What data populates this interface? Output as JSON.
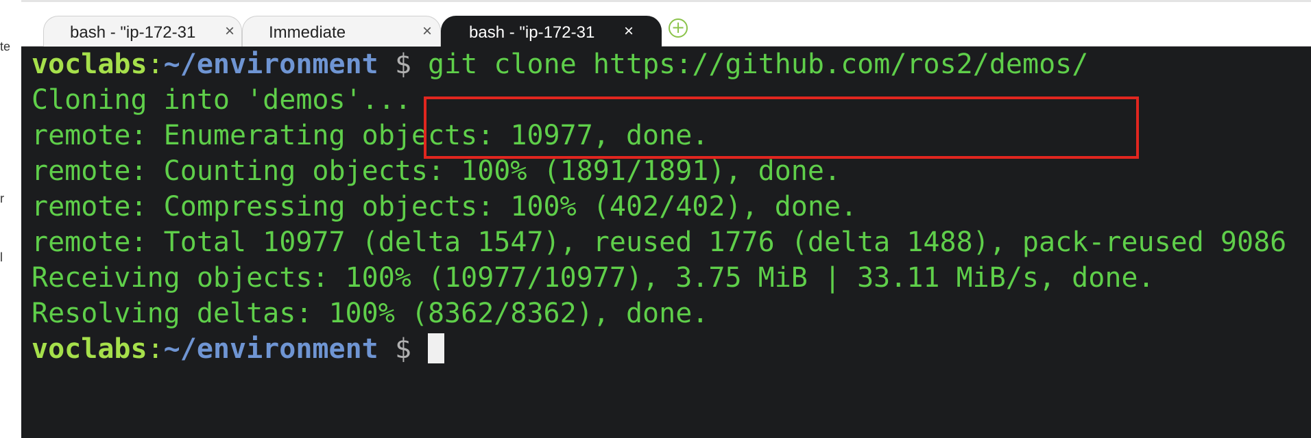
{
  "left_strip": {
    "fragments": [
      "te",
      "r",
      "l"
    ]
  },
  "tabs": [
    {
      "label": "bash - \"ip-172-31",
      "close": "×",
      "active": false
    },
    {
      "label": "Immediate",
      "close": "×",
      "active": false
    },
    {
      "label": "bash - \"ip-172-31",
      "close": "×",
      "active": true
    }
  ],
  "add_tab": {
    "icon": "plus-circle-icon",
    "glyph": "+"
  },
  "colors": {
    "terminal_bg": "#1b1c1e",
    "output_green": "#5fcf4a",
    "host_green": "#a6e04b",
    "path_blue": "#6f95d3",
    "highlight_red": "#e1261f"
  },
  "terminal": {
    "prompt": {
      "host": "voclabs",
      "colon": ":",
      "path": "~/environment",
      "symbol": "$"
    },
    "command": "git clone https://github.com/ros2/demos/",
    "output": [
      "Cloning into 'demos'...",
      "remote: Enumerating objects: 10977, done.",
      "remote: Counting objects: 100% (1891/1891), done.",
      "remote: Compressing objects: 100% (402/402), done.",
      "remote: Total 10977 (delta 1547), reused 1776 (delta 1488), pack-reused 9086",
      "Receiving objects: 100% (10977/10977), 3.75 MiB | 33.11 MiB/s, done.",
      "Resolving deltas: 100% (8362/8362), done."
    ]
  }
}
